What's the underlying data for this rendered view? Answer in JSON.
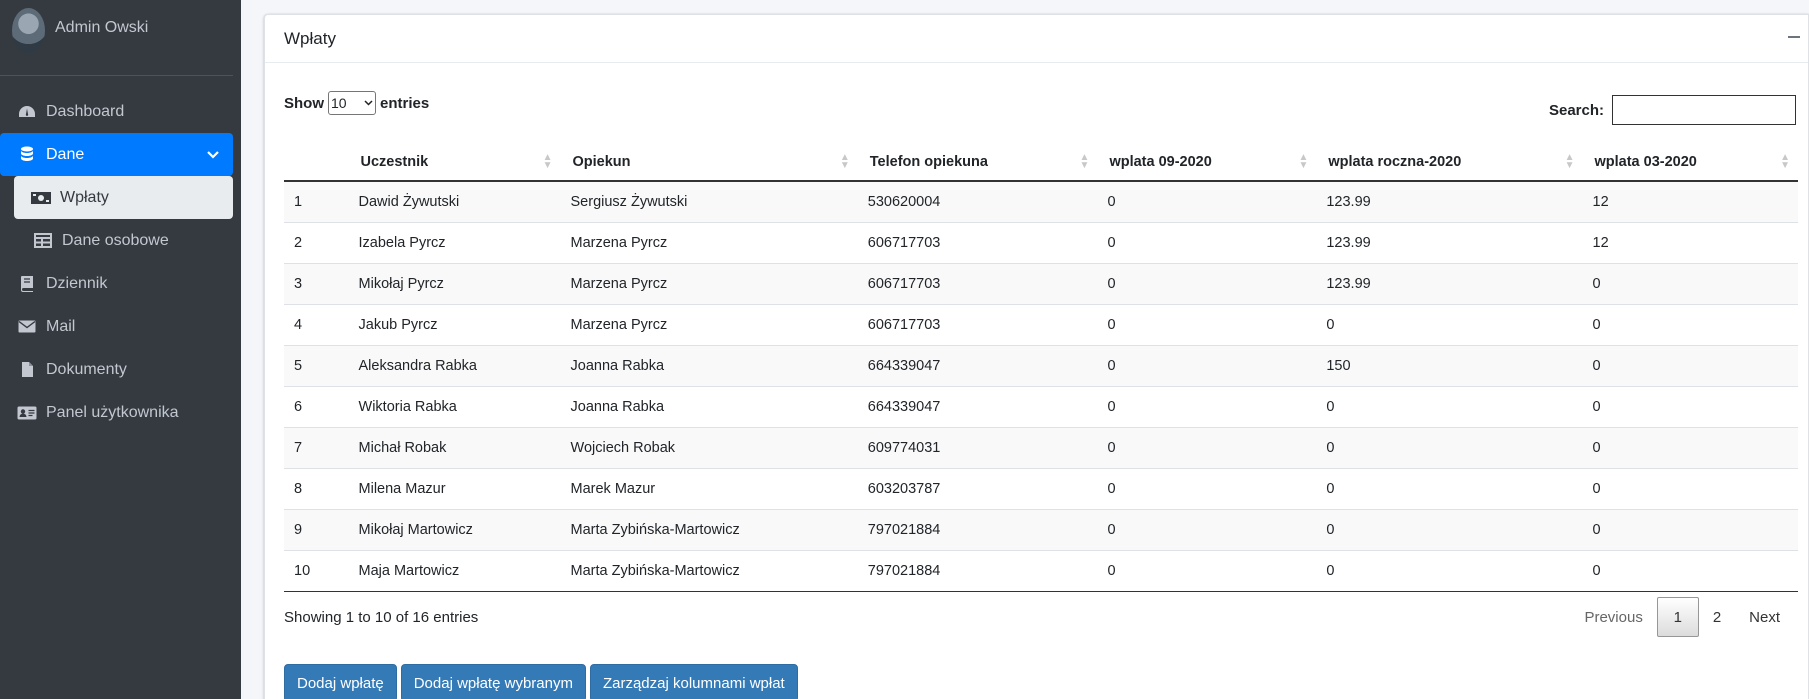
{
  "user": {
    "name": "Admin Owski"
  },
  "sidebar": {
    "items": [
      {
        "label": "Dashboard",
        "icon": "dashboard-icon"
      },
      {
        "label": "Dane",
        "icon": "database-icon"
      },
      {
        "label": "Wpłaty",
        "icon": "money-icon"
      },
      {
        "label": "Dane osobowe",
        "icon": "table-icon"
      },
      {
        "label": "Dziennik",
        "icon": "book-icon"
      },
      {
        "label": "Mail",
        "icon": "envelope-icon"
      },
      {
        "label": "Dokumenty",
        "icon": "file-icon"
      },
      {
        "label": "Panel użytkownika",
        "icon": "id-card-icon"
      }
    ]
  },
  "card": {
    "title": "Wpłaty"
  },
  "controls": {
    "show_label": "Show",
    "entries_label": "entries",
    "page_length": "10",
    "search_label": "Search:",
    "search_value": ""
  },
  "table": {
    "columns": [
      "",
      "Uczestnik",
      "Opiekun",
      "Telefon opiekuna",
      "wplata 09-2020",
      "wplata roczna-2020",
      "wplata 03-2020"
    ],
    "rows": [
      [
        "1",
        "Dawid Żywutski",
        "Sergiusz Żywutski",
        "530620004",
        "0",
        "123.99",
        "12"
      ],
      [
        "2",
        "Izabela Pyrcz",
        "Marzena Pyrcz",
        "606717703",
        "0",
        "123.99",
        "12"
      ],
      [
        "3",
        "Mikołaj Pyrcz",
        "Marzena Pyrcz",
        "606717703",
        "0",
        "123.99",
        "0"
      ],
      [
        "4",
        "Jakub Pyrcz",
        "Marzena Pyrcz",
        "606717703",
        "0",
        "0",
        "0"
      ],
      [
        "5",
        "Aleksandra Rabka",
        "Joanna Rabka",
        "664339047",
        "0",
        "150",
        "0"
      ],
      [
        "6",
        "Wiktoria Rabka",
        "Joanna Rabka",
        "664339047",
        "0",
        "0",
        "0"
      ],
      [
        "7",
        "Michał Robak",
        "Wojciech Robak",
        "609774031",
        "0",
        "0",
        "0"
      ],
      [
        "8",
        "Milena Mazur",
        "Marek Mazur",
        "603203787",
        "0",
        "0",
        "0"
      ],
      [
        "9",
        "Mikołaj Martowicz",
        "Marta Zybińska-Martowicz",
        "797021884",
        "0",
        "0",
        "0"
      ],
      [
        "10",
        "Maja Martowicz",
        "Marta Zybińska-Martowicz",
        "797021884",
        "0",
        "0",
        "0"
      ]
    ]
  },
  "footer": {
    "info": "Showing 1 to 10 of 16 entries",
    "previous": "Previous",
    "pages": [
      "1",
      "2"
    ],
    "next": "Next"
  },
  "buttons": {
    "add": "Dodaj wpłatę",
    "add_selected": "Dodaj wpłatę wybranym",
    "manage_columns": "Zarządzaj kolumnami wpłat"
  },
  "colors": {
    "sidebar_bg": "#343a40",
    "active": "#007bff",
    "button": "#337ab7"
  }
}
